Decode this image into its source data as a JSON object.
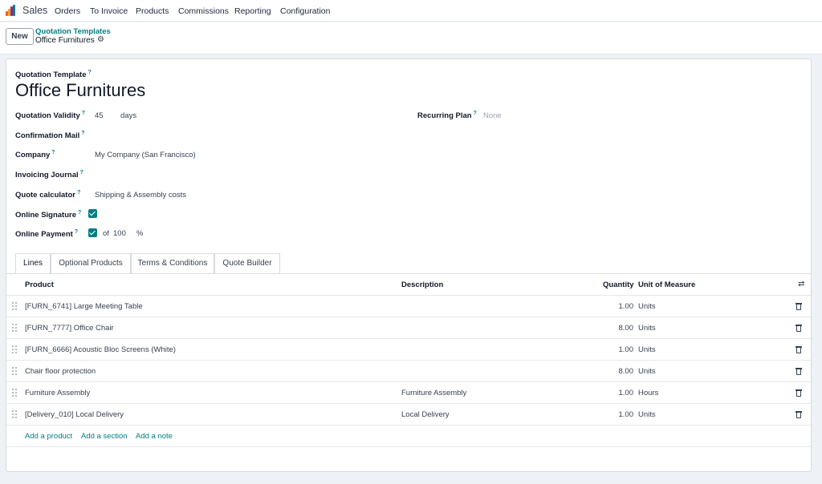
{
  "nav": {
    "app_name": "Sales",
    "menu": [
      "Orders",
      "To Invoice",
      "Products",
      "Commissions",
      "Reporting",
      "Configuration"
    ],
    "logo_colors": [
      "#f05a28",
      "#f7a21b",
      "#8e2b8a",
      "#017e84"
    ]
  },
  "control": {
    "new_label": "New",
    "breadcrumb_parent": "Quotation Templates",
    "breadcrumb_current": "Office Furnitures",
    "gear_icon": "⚙"
  },
  "form": {
    "template_label": "Quotation Template",
    "title": "Office Furnitures",
    "help_mark": "?",
    "validity_label": "Quotation Validity",
    "validity_value": "45",
    "validity_unit": "days",
    "recurring_label": "Recurring Plan",
    "recurring_value": "None",
    "confirmation_label": "Confirmation Mail",
    "company_label": "Company",
    "company_value": "My Company (San Francisco)",
    "journal_label": "Invoicing Journal",
    "calculator_label": "Quote calculator",
    "calculator_value": "Shipping & Assembly costs",
    "signature_label": "Online Signature",
    "signature_checked": true,
    "payment_label": "Online Payment",
    "payment_checked": true,
    "payment_of": "of",
    "payment_percent": "100",
    "payment_percent_sign": "%"
  },
  "tabs": [
    "Lines",
    "Optional Products",
    "Terms & Conditions",
    "Quote Builder"
  ],
  "table": {
    "headers": {
      "product": "Product",
      "description": "Description",
      "quantity": "Quantity",
      "uom": "Unit of Measure",
      "swap_icon": "⇄"
    },
    "rows": [
      {
        "product": "[FURN_6741] Large Meeting Table",
        "description": "",
        "quantity": "1.00",
        "uom": "Units"
      },
      {
        "product": "[FURN_7777] Office Chair",
        "description": "",
        "quantity": "8.00",
        "uom": "Units"
      },
      {
        "product": "[FURN_6666] Acoustic Bloc Screens (White)",
        "description": "",
        "quantity": "1.00",
        "uom": "Units"
      },
      {
        "product": "Chair floor protection",
        "description": "",
        "quantity": "8.00",
        "uom": "Units"
      },
      {
        "product": "Furniture Assembly",
        "description": "Furniture Assembly",
        "quantity": "1.00",
        "uom": "Hours"
      },
      {
        "product": "[Delivery_010] Local Delivery",
        "description": "Local Delivery",
        "quantity": "1.00",
        "uom": "Units"
      }
    ],
    "add_product": "Add a product",
    "add_section": "Add a section",
    "add_note": "Add a note"
  }
}
